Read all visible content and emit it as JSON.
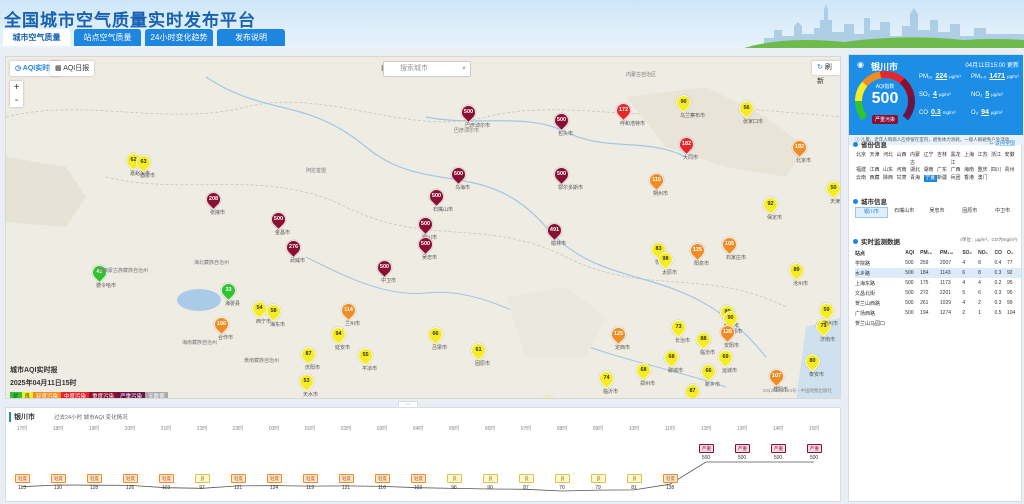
{
  "header": {
    "title": "全国城市空气质量实时发布平台",
    "tabs": [
      "城市空气质量",
      "站点空气质量",
      "24小时变化趋势",
      "发布说明"
    ]
  },
  "map": {
    "btn_aqi_realtime": "AQI实时报",
    "btn_aqi_daily": "AQI日报",
    "search_placeholder": "搜索城市",
    "reset_label": "刷新",
    "zoom_in": "+",
    "zoom_out": "-",
    "legend_title": "城市AQI实时报",
    "legend_date": "2025年04月11日15时",
    "legend_levels": [
      {
        "label": "优",
        "color": "#2fc42f"
      },
      {
        "label": "良",
        "color": "#f5ec25"
      },
      {
        "label": "轻度污染",
        "color": "#f08c24"
      },
      {
        "label": "中度污染",
        "color": "#e5262b"
      },
      {
        "label": "重度污染",
        "color": "#8a1033"
      },
      {
        "label": "严重污染",
        "color": "#6a1446"
      },
      {
        "label": "无数据",
        "color": "#aaaaaa"
      }
    ],
    "copyright": "GS(2022)2124号 - 中国地图出版社",
    "pins": [
      {
        "v": "500",
        "c": "maroon",
        "n": "巴彦淖尔市"
      },
      {
        "v": "500",
        "c": "maroon",
        "n": "包头市"
      },
      {
        "v": "172",
        "c": "red",
        "n": "呼和浩特市"
      },
      {
        "v": "90",
        "c": "yellow",
        "n": "乌兰察布市"
      },
      {
        "v": "56",
        "c": "yellow",
        "n": "张家口市"
      },
      {
        "v": "182",
        "c": "red",
        "n": "大同市"
      },
      {
        "v": "192",
        "c": "orange",
        "n": "北京市"
      },
      {
        "v": "62",
        "c": "yellow",
        "n": "嘉峪关市"
      },
      {
        "v": "63",
        "c": "yellow",
        "n": "酒泉市"
      },
      {
        "v": "500",
        "c": "maroon",
        "n": "乌海市"
      },
      {
        "v": "500",
        "c": "maroon",
        "n": "鄂尔多斯市"
      },
      {
        "v": "208",
        "c": "maroon",
        "n": "张掖市"
      },
      {
        "v": "500",
        "c": "maroon",
        "n": "石嘴山市"
      },
      {
        "v": "500",
        "c": "maroon",
        "n": "金昌市"
      },
      {
        "v": "500",
        "c": "maroon",
        "n": "银川市"
      },
      {
        "v": "276",
        "c": "maroon",
        "n": "武威市"
      },
      {
        "v": "500",
        "c": "maroon",
        "n": "吴忠市"
      },
      {
        "v": "491",
        "c": "maroon",
        "n": "榆林市"
      },
      {
        "v": "115",
        "c": "orange",
        "n": "朔州市"
      },
      {
        "v": "50",
        "c": "yellow",
        "n": "天津市"
      },
      {
        "v": "92",
        "c": "yellow",
        "n": "保定市"
      },
      {
        "v": "45",
        "c": "good",
        "n": "德令哈市"
      },
      {
        "v": "500",
        "c": "maroon",
        "n": "中卫市"
      },
      {
        "v": "83",
        "c": "yellow",
        "n": "忻州市"
      },
      {
        "v": "98",
        "c": "yellow",
        "n": "太原市"
      },
      {
        "v": "125",
        "c": "orange",
        "n": "阳泉市"
      },
      {
        "v": "105",
        "c": "orange",
        "n": "石家庄市"
      },
      {
        "v": "89",
        "c": "yellow",
        "n": "沧州市"
      },
      {
        "v": "33",
        "c": "good",
        "n": "海晏县"
      },
      {
        "v": "54",
        "c": "yellow",
        "n": "西宁市"
      },
      {
        "v": "58",
        "c": "yellow",
        "n": "海东市"
      },
      {
        "v": "114",
        "c": "orange",
        "n": "兰州市"
      },
      {
        "v": "94",
        "c": "yellow",
        "n": "延安市"
      },
      {
        "v": "66",
        "c": "yellow",
        "n": "吕梁市"
      },
      {
        "v": "89",
        "c": "yellow",
        "n": "邢台市"
      },
      {
        "v": "90",
        "c": "yellow",
        "n": "邯郸市"
      },
      {
        "v": "71",
        "c": "yellow",
        "n": "济南市"
      },
      {
        "v": "59",
        "c": "yellow",
        "n": "德州市"
      },
      {
        "v": "61",
        "c": "yellow",
        "n": "固原市"
      },
      {
        "v": "87",
        "c": "yellow",
        "n": "庆阳市"
      },
      {
        "v": "125",
        "c": "orange",
        "n": "定西市"
      },
      {
        "v": "88",
        "c": "yellow",
        "n": "临汾市"
      },
      {
        "v": "73",
        "c": "yellow",
        "n": "长治市"
      },
      {
        "v": "126",
        "c": "orange",
        "n": "安阳市"
      },
      {
        "v": "68",
        "c": "yellow",
        "n": "聊城市"
      },
      {
        "v": "106",
        "c": "orange",
        "n": "合作市"
      },
      {
        "v": "55",
        "c": "yellow",
        "n": "平凉市"
      },
      {
        "v": "53",
        "c": "yellow",
        "n": "天水市"
      },
      {
        "v": "69",
        "c": "yellow",
        "n": "运城市"
      },
      {
        "v": "66",
        "c": "yellow",
        "n": "新乡市"
      },
      {
        "v": "107",
        "c": "orange",
        "n": "濮阳市"
      },
      {
        "v": "80",
        "c": "yellow",
        "n": "泰安市"
      },
      {
        "v": "74",
        "c": "yellow",
        "n": "临沂市"
      },
      {
        "v": "68",
        "c": "yellow",
        "n": "郑州市"
      },
      {
        "v": "87",
        "c": "yellow",
        "n": "菏泽市"
      },
      {
        "v": "60",
        "c": "yellow",
        "n": "洛阳市"
      },
      {
        "v": "85",
        "c": "yellow",
        "n": "开封市"
      },
      {
        "v": "83",
        "c": "yellow",
        "n": "商丘市"
      }
    ],
    "labels": [
      "内蒙古自治区",
      "海北藏族自治州",
      "海西蒙古族藏族自治州",
      "海南藏族自治州",
      "黄南藏族自治州",
      "巴彦淖尔市",
      "阿拉善盟"
    ]
  },
  "panel": {
    "city": "银川市",
    "time": "04月11日15:00",
    "time_suffix": "更新",
    "aqi_label": "AQI指数",
    "aqi": "500",
    "level": "严重污染",
    "pollutants": [
      {
        "name": "PM₁₀",
        "value": "224",
        "unit": "μg/m³"
      },
      {
        "name": "PM₂.₅",
        "value": "1471",
        "unit": "μg/m³"
      },
      {
        "name": "SO₂",
        "value": "4",
        "unit": "μg/m³"
      },
      {
        "name": "NO₂",
        "value": "5",
        "unit": "μg/m³"
      },
      {
        "name": "CO",
        "value": "0.3",
        "unit": "mg/m³"
      },
      {
        "name": "O₃",
        "value": "94",
        "unit": "μg/m³"
      }
    ],
    "advice": "儿童、老年人和病人应停留在室内，避免体力消耗，一般人群避免户外活动。",
    "prov_title": "省份信息",
    "prov_more": "返回全国",
    "provinces": [
      "北京",
      "天津",
      "河北",
      "山西",
      "内蒙古",
      "辽宁",
      "吉林",
      "黑龙江",
      "上海",
      "江苏",
      "浙江",
      "安徽",
      "福建",
      "江西",
      "山东",
      "河南",
      "湖北",
      "湖南",
      "广东",
      "广西",
      "海南",
      "重庆",
      "四川",
      "贵州",
      "云南",
      "西藏",
      "陕西",
      "甘肃",
      "青海",
      "宁夏",
      "新疆",
      "兵团",
      "香港",
      "澳门"
    ],
    "prov_selected": "宁夏",
    "city_title": "城市信息",
    "cities": [
      "银川市",
      "石嘴山市",
      "吴忠市",
      "固原市",
      "中卫市"
    ],
    "city_selected": "银川市",
    "monitor_title": "实时监测数据",
    "monitor_unit": "(单位：μg/m³，CO为mg/m³)",
    "table_headers": [
      "站点",
      "AQI",
      "PM₁₀",
      "PM₂.₅",
      "SO₂",
      "NO₂",
      "CO",
      "O₃"
    ],
    "table_rows": [
      [
        "学院路",
        "500",
        "259",
        "2007",
        "4",
        "8",
        "0.4",
        "77"
      ],
      [
        "水乡路",
        "500",
        "184",
        "1143",
        "6",
        "8",
        "0.3",
        "92"
      ],
      [
        "上海东路",
        "500",
        "175",
        "1173",
        "4",
        "4",
        "0.2",
        "95"
      ],
      [
        "文昌北街",
        "500",
        "272",
        "2201",
        "5",
        "6",
        "0.3",
        "95"
      ],
      [
        "贺兰山西路",
        "500",
        "261",
        "1029",
        "4",
        "2",
        "0.3",
        "99"
      ],
      [
        "广场西路",
        "500",
        "194",
        "1274",
        "2",
        "1",
        "0.5",
        "104"
      ],
      [
        "贺兰山马园口",
        "",
        "",
        "",
        "",
        "",
        "",
        ""
      ]
    ]
  },
  "trend": {
    "city": "银川市",
    "subtitle": "过去24小时 城市AQI 变化情况",
    "hours": [
      "17时",
      "18时",
      "19时",
      "20时",
      "21时",
      "22时",
      "23时",
      "00时",
      "01时",
      "02时",
      "03时",
      "04时",
      "05时",
      "06时",
      "07时",
      "08时",
      "09时",
      "10时",
      "11时",
      "12时",
      "13时",
      "14时",
      "15时"
    ],
    "levels": [
      "轻度",
      "轻度",
      "轻度",
      "轻度",
      "轻度",
      "良",
      "轻度",
      "轻度",
      "轻度",
      "轻度",
      "轻度",
      "轻度",
      "良",
      "良",
      "良",
      "良",
      "良",
      "良",
      "轻度",
      "严重",
      "严重",
      "严重",
      "严重"
    ],
    "values": [
      113,
      130,
      128,
      126,
      103,
      97,
      121,
      124,
      119,
      121,
      116,
      103,
      96,
      90,
      87,
      70,
      79,
      81,
      138,
      500,
      500,
      500,
      500
    ]
  }
}
